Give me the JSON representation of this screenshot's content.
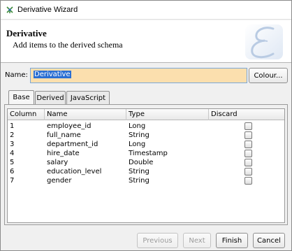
{
  "window": {
    "title": "Derivative Wizard"
  },
  "header": {
    "title": "Derivative",
    "subtitle": "Add items to the derived schema",
    "logo_icon": "script-e-logo"
  },
  "form": {
    "name_label": "Name:",
    "name_value": "Derivative",
    "colour_button": "Colour..."
  },
  "tabs": [
    {
      "label": "Base",
      "active": true
    },
    {
      "label": "Derived",
      "active": false
    },
    {
      "label": "JavaScript",
      "active": false
    }
  ],
  "table": {
    "columns": [
      "Column",
      "Name",
      "Type",
      "Discard"
    ],
    "rows": [
      {
        "column": "1",
        "name": "employee_id",
        "type": "Long",
        "discard": false
      },
      {
        "column": "2",
        "name": "full_name",
        "type": "String",
        "discard": false
      },
      {
        "column": "3",
        "name": "department_id",
        "type": "Long",
        "discard": false
      },
      {
        "column": "4",
        "name": "hire_date",
        "type": "Timestamp",
        "discard": false
      },
      {
        "column": "5",
        "name": "salary",
        "type": "Double",
        "discard": false
      },
      {
        "column": "6",
        "name": "education_level",
        "type": "String",
        "discard": false
      },
      {
        "column": "7",
        "name": "gender",
        "type": "String",
        "discard": false
      }
    ]
  },
  "footer": {
    "previous": "Previous",
    "next": "Next",
    "finish": "Finish",
    "cancel": "Cancel"
  }
}
